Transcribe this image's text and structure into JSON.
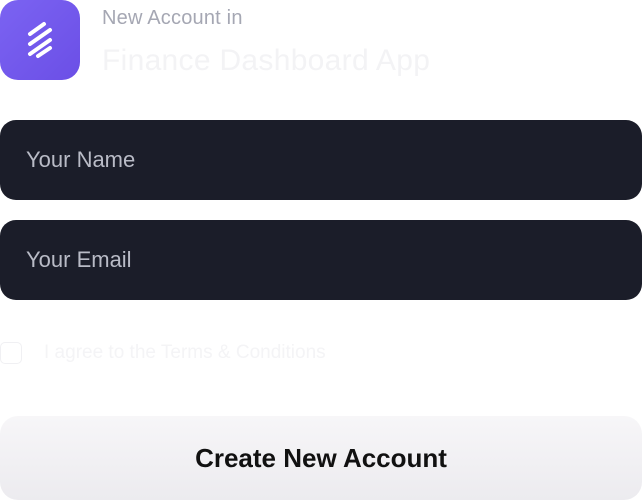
{
  "brand": {
    "logo_icon": "stripes-logo-icon",
    "accent": "#6b4fe6"
  },
  "header": {
    "subtitle": "New Account in",
    "title": "Finance Dashboard App"
  },
  "form": {
    "name_placeholder": "Your Name",
    "name_value": "",
    "email_placeholder": "Your Email",
    "email_value": "",
    "agree_label": "I agree to the Terms & Conditions",
    "agree_checked": false,
    "submit_label": "Create New Account"
  },
  "colors": {
    "field_bg": "#1b1d29",
    "button_bg": "#f1f0f3"
  }
}
